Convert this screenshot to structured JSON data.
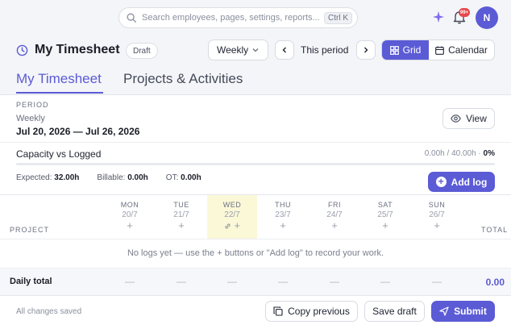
{
  "search": {
    "placeholder": "Search employees, pages, settings, reports...",
    "shortcut": "Ctrl K"
  },
  "header": {
    "notifications_badge": "99+",
    "avatar_initial": "N"
  },
  "page": {
    "title": "My Timesheet",
    "status_badge": "Draft"
  },
  "controls": {
    "range_select": "Weekly",
    "period_label": "This period",
    "view_grid": "Grid",
    "view_calendar": "Calendar"
  },
  "tabs": [
    {
      "label": "My Timesheet",
      "active": true
    },
    {
      "label": "Projects & Activities",
      "active": false
    }
  ],
  "period": {
    "heading": "PERIOD",
    "type": "Weekly",
    "range": "Jul 20, 2026 — Jul 26, 2026",
    "view_button": "View"
  },
  "capacity": {
    "label": "Capacity vs Logged",
    "value": "0.00h / 40.00h",
    "percent": "0%",
    "fill_fraction": 0
  },
  "stats": {
    "expected_label": "Expected:",
    "expected_value": "32.00h",
    "billable_label": "Billable:",
    "billable_value": "0.00h",
    "ot_label": "OT:",
    "ot_value": "0.00h"
  },
  "add_log_label": "Add log",
  "table": {
    "project_header": "PROJECT",
    "total_header": "TOTAL",
    "days": [
      {
        "name": "MON",
        "date": "20/7",
        "add": "+"
      },
      {
        "name": "TUE",
        "date": "21/7",
        "add": "+"
      },
      {
        "name": "WED",
        "date": "22/7",
        "add": "+"
      },
      {
        "name": "THU",
        "date": "23/7",
        "add": "+"
      },
      {
        "name": "FRI",
        "date": "24/7",
        "add": "+"
      },
      {
        "name": "SAT",
        "date": "25/7",
        "add": "+"
      },
      {
        "name": "SUN",
        "date": "26/7",
        "add": "+"
      }
    ],
    "empty_message": "No logs yet — use the + buttons or \"Add log\" to record your work.",
    "daily_total_label": "Daily total",
    "daily_totals": [
      "—",
      "—",
      "—",
      "—",
      "—",
      "—",
      "—"
    ],
    "grand_total": "0.00"
  },
  "footer": {
    "status": "All changes saved",
    "copy_previous": "Copy previous",
    "save_draft": "Save draft",
    "submit": "Submit"
  },
  "colors": {
    "accent": "#5b5bd6",
    "today_highlight": "#fbf8d8",
    "badge": "#e5484d"
  }
}
